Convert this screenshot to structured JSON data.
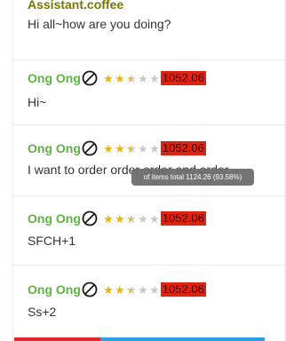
{
  "greeting": {
    "author": "Assistant.coffee",
    "text": "Hi all~how are you doing?"
  },
  "messages": [
    {
      "name": "Ong Ong",
      "rating": 2.5,
      "score": "1052.06",
      "text": "Hi~"
    },
    {
      "name": "Ong Ong",
      "rating": 2.5,
      "score": "1052.06",
      "text": "I want to order order order and order"
    },
    {
      "name": "Ong Ong",
      "rating": 2.5,
      "score": "1052.06",
      "text": "SFCH+1"
    },
    {
      "name": "Ong Ong",
      "rating": 2.5,
      "score": "1052.06",
      "text": "Ss+2"
    }
  ],
  "tooltip": {
    "text": "of items total 1124.26 (93.58%)"
  },
  "colors": {
    "name": "#5fb340",
    "author": "#777700",
    "score_bg": "#e8200a",
    "star": "#f0b400",
    "bar_red": "#e8242a",
    "bar_blue": "#2a9fe6"
  }
}
